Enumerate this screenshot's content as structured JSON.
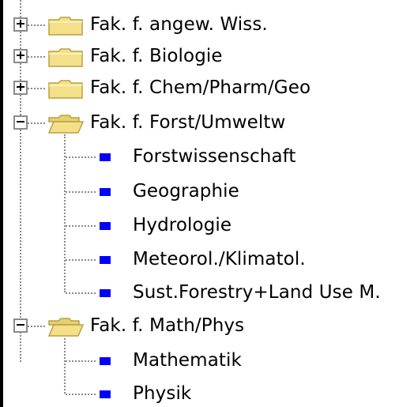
{
  "tree": {
    "nodes": [
      {
        "label": "Fak. f. angew. Wiss.",
        "expander": "+",
        "state": "collapsed",
        "icon": "folder-closed-icon"
      },
      {
        "label": "Fak. f. Biologie",
        "expander": "+",
        "state": "collapsed",
        "icon": "folder-closed-icon"
      },
      {
        "label": "Fak. f. Chem/Pharm/Geo",
        "expander": "+",
        "state": "collapsed",
        "icon": "folder-closed-icon"
      },
      {
        "label": "Fak. f. Forst/Umweltw",
        "expander": "−",
        "state": "expanded",
        "icon": "folder-open-icon",
        "children": [
          "Forstwissenschaft",
          "Geographie",
          "Hydrologie",
          "Meteorol./Klimatol.",
          "Sust.Forestry+Land Use M."
        ]
      },
      {
        "label": "Fak. f. Math/Phys",
        "expander": "−",
        "state": "expanded",
        "icon": "folder-open-icon",
        "children": [
          "Mathematik",
          "Physik"
        ]
      }
    ]
  },
  "colors": {
    "leaf_square": "#0000ff",
    "folder_fill": "#f5e08a",
    "folder_outline": "#b8a040",
    "tree_lines": "#8a8a8a"
  }
}
